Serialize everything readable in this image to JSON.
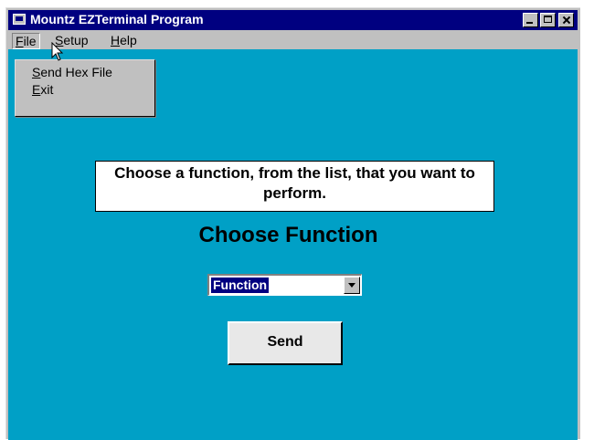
{
  "window": {
    "title": "Mountz EZTerminal Program"
  },
  "menubar": {
    "file": {
      "hotkey": "F",
      "rest": "ile"
    },
    "setup": {
      "hotkey": "S",
      "rest": "etup"
    },
    "help": {
      "hotkey": "H",
      "rest": "elp"
    }
  },
  "file_menu": {
    "items": [
      {
        "hotkey": "S",
        "rest": "end Hex File"
      },
      {
        "hotkey": "E",
        "rest": "xit"
      }
    ]
  },
  "main": {
    "prompt": "Choose a function, from the list, that you want to perform.",
    "heading": "Choose Function",
    "function_select": {
      "value": "Function"
    },
    "send_label": "Send"
  },
  "colors": {
    "client_bg": "#00a0c6",
    "titlebar": "#000080"
  },
  "icons": {
    "title": "app-window-icon",
    "cursor": "mouse-pointer-icon"
  }
}
